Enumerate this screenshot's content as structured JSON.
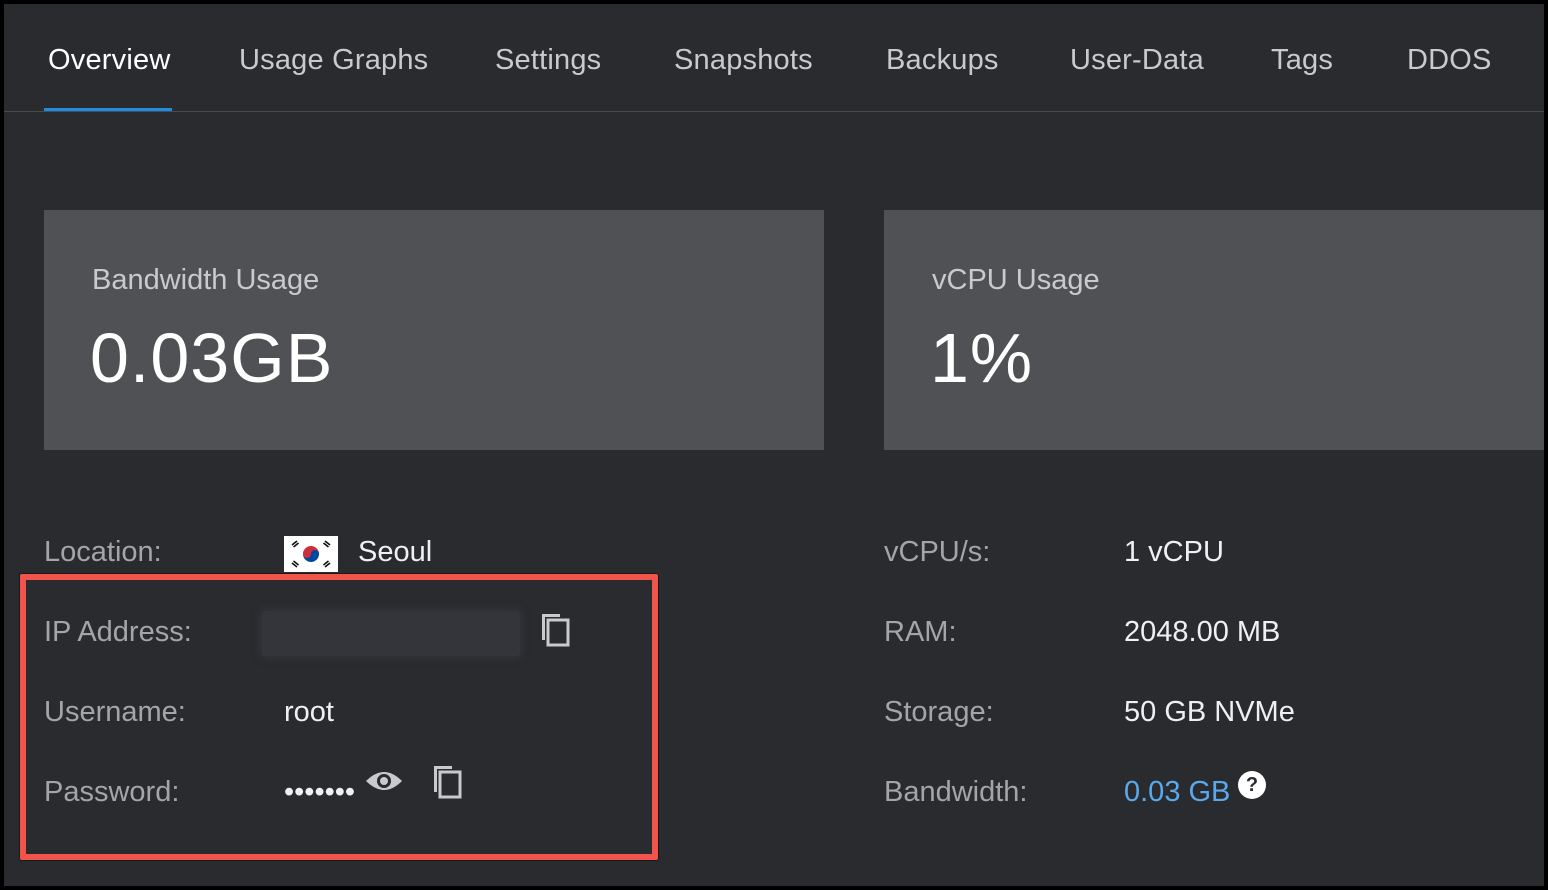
{
  "tabs": [
    {
      "label": "Overview",
      "active": true
    },
    {
      "label": "Usage Graphs",
      "active": false
    },
    {
      "label": "Settings",
      "active": false
    },
    {
      "label": "Snapshots",
      "active": false
    },
    {
      "label": "Backups",
      "active": false
    },
    {
      "label": "User-Data",
      "active": false
    },
    {
      "label": "Tags",
      "active": false
    },
    {
      "label": "DDOS",
      "active": false
    }
  ],
  "cards": {
    "bandwidth": {
      "label": "Bandwidth Usage",
      "value": "0.03GB"
    },
    "vcpu": {
      "label": "vCPU Usage",
      "value": "1%"
    }
  },
  "details_left": {
    "location": {
      "label": "Location:",
      "value": "Seoul"
    },
    "ip": {
      "label": "IP Address:"
    },
    "username": {
      "label": "Username:",
      "value": "root"
    },
    "password": {
      "label": "Password:",
      "value": "•••••••"
    }
  },
  "details_right": {
    "vcpus": {
      "label": "vCPU/s:",
      "value": "1 vCPU"
    },
    "ram": {
      "label": "RAM:",
      "value": "2048.00 MB"
    },
    "storage": {
      "label": "Storage:",
      "value": "50 GB NVMe"
    },
    "bandwidth": {
      "label": "Bandwidth:",
      "value": "0.03 GB"
    }
  },
  "help_glyph": "?",
  "colors": {
    "accent": "#1e8fe0",
    "highlight": "#f1544a",
    "link": "#5aa9ec"
  }
}
